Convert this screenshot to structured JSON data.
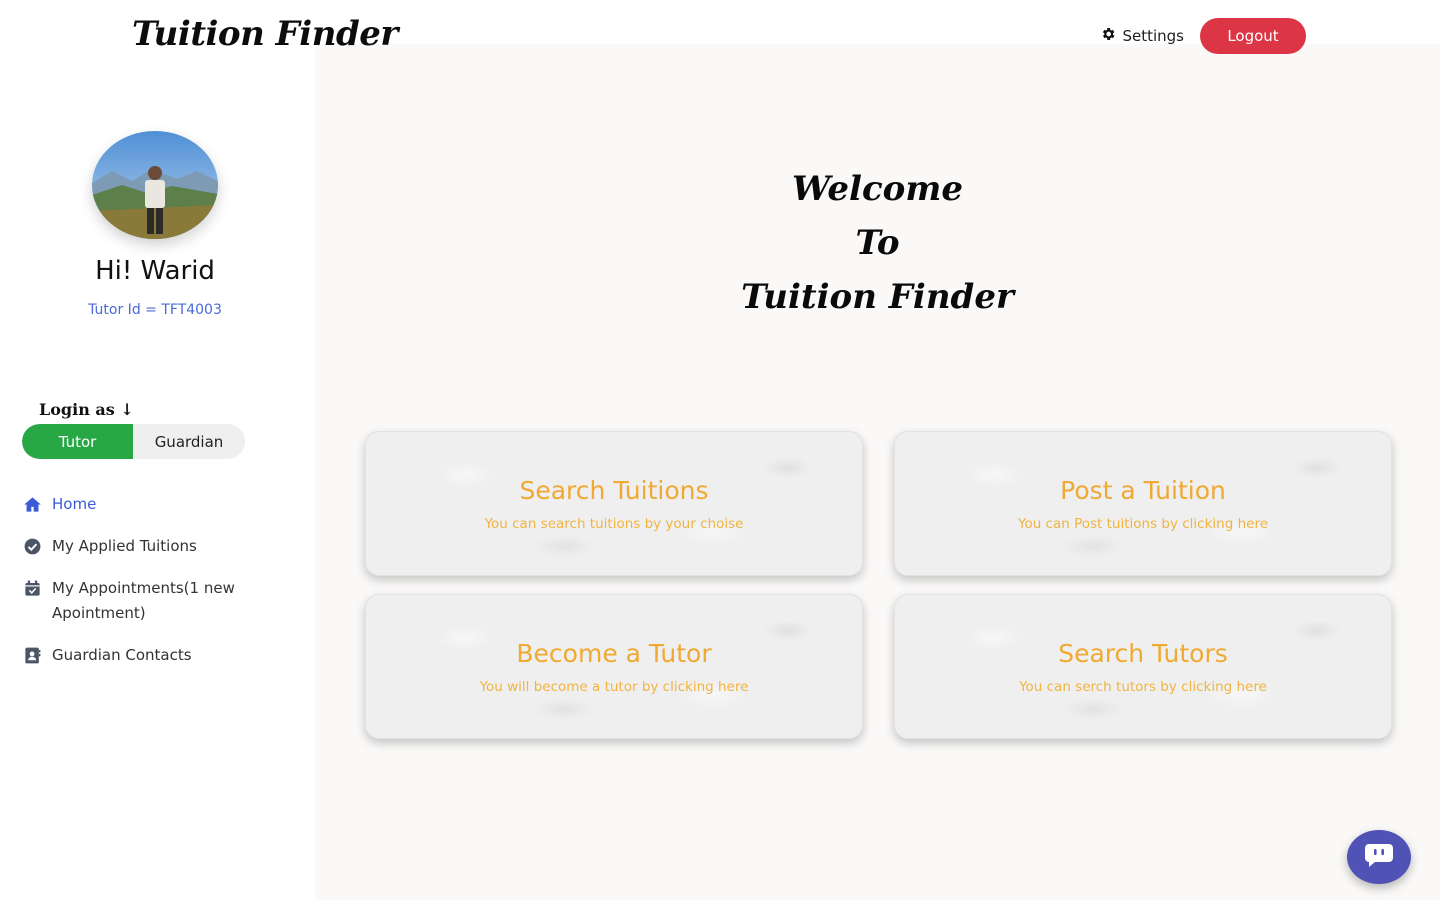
{
  "brand": {
    "name": "Tuition Finder"
  },
  "header": {
    "settings_label": "Settings",
    "logout_label": "Logout"
  },
  "profile": {
    "greeting": "Hi! Warid",
    "tutor_id": "Tutor Id = TFT4003"
  },
  "login_as": {
    "label": "Login as ↓",
    "options": [
      "Tutor",
      "Guardian"
    ],
    "selected": "Tutor"
  },
  "sidebar": {
    "items": [
      {
        "label": "Home",
        "icon": "home-icon",
        "active": true
      },
      {
        "label": "My Applied Tuitions",
        "icon": "check-circle-icon"
      },
      {
        "label": "My Appointments(1 new Apointment)",
        "icon": "calendar-check-icon"
      },
      {
        "label": "Guardian Contacts",
        "icon": "contact-book-icon"
      }
    ]
  },
  "welcome": {
    "line1": "Welcome",
    "line2": "To",
    "line3": "Tuition Finder"
  },
  "cards": [
    {
      "title": "Search Tuitions",
      "subtitle": "You can search tuitions by your choise"
    },
    {
      "title": "Post a Tuition",
      "subtitle": "You can Post tuitions by clicking here"
    },
    {
      "title": "Become a Tutor",
      "subtitle": "You will become a tutor by clicking here"
    },
    {
      "title": "Search Tutors",
      "subtitle": "You can serch tutors by clicking here"
    }
  ],
  "chat": {
    "icon": "chat-bubble-icon"
  },
  "colors": {
    "logout": "#dc3545",
    "tutor_active": "#28a745",
    "accent_blue": "#3b5bd6",
    "card_text": "#f0a932",
    "chat_button": "#5052b5"
  }
}
